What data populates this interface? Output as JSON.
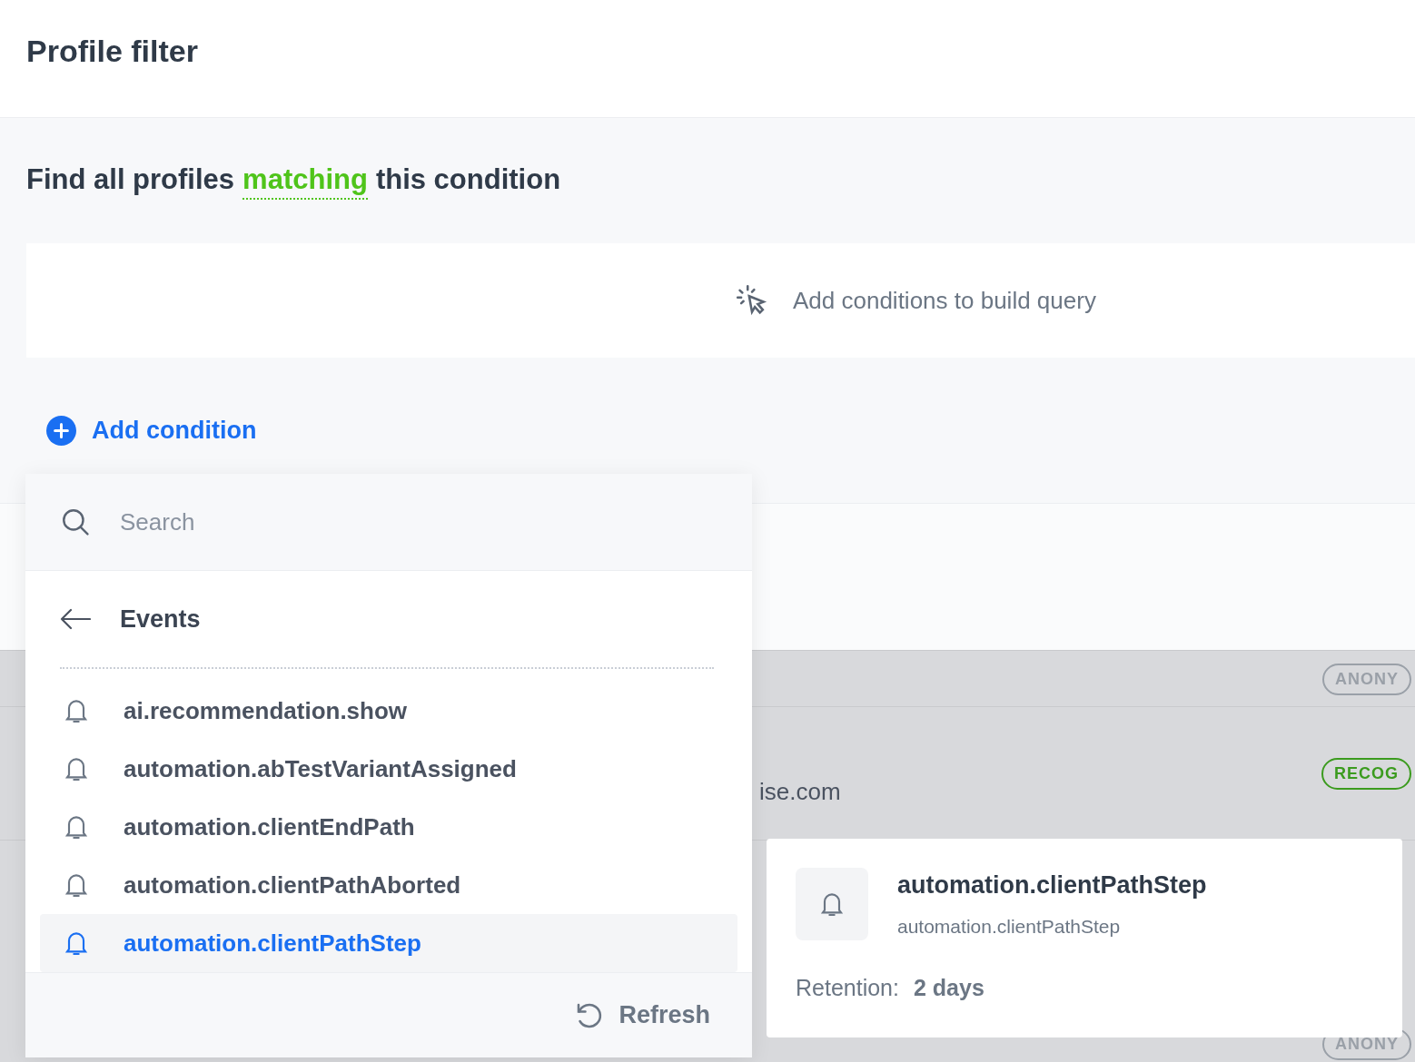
{
  "header": {
    "title": "Profile filter"
  },
  "condition": {
    "prefix": "Find all profiles",
    "mode": "matching",
    "suffix": "this condition"
  },
  "query": {
    "placeholder": "Add conditions to build query"
  },
  "add_button": "Add condition",
  "background_rows": [
    {
      "badge": "ANONY",
      "kind": "anonymous"
    },
    {
      "text": "ise.com",
      "badge": "RECOG",
      "kind": "recognized"
    },
    {
      "badge": "ANONY",
      "kind": "anonymous"
    }
  ],
  "dropdown": {
    "search": {
      "placeholder": "Search"
    },
    "back_label": "Events",
    "items": [
      {
        "label": "ai.recommendation.show",
        "selected": false
      },
      {
        "label": "automation.abTestVariantAssigned",
        "selected": false
      },
      {
        "label": "automation.clientEndPath",
        "selected": false
      },
      {
        "label": "automation.clientPathAborted",
        "selected": false
      },
      {
        "label": "automation.clientPathStep",
        "selected": true
      }
    ],
    "refresh": "Refresh"
  },
  "tooltip": {
    "title": "automation.clientPathStep",
    "subtitle": "automation.clientPathStep",
    "retention_label": "Retention:",
    "retention_value": "2 days"
  }
}
